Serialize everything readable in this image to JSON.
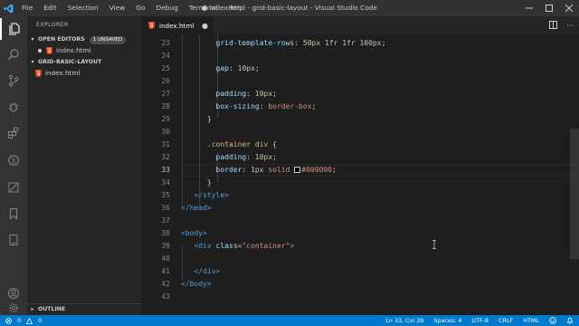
{
  "window": {
    "title": "● index.html - grid-basic-layout - Visual Studio Code",
    "menu": [
      "File",
      "Edit",
      "Selection",
      "View",
      "Go",
      "Debug",
      "Terminal",
      "Help"
    ],
    "controls": [
      "minimize-icon",
      "maximize-icon",
      "close-icon"
    ]
  },
  "activitybar": {
    "icons": [
      "files-icon",
      "search-icon",
      "source-control-icon",
      "debug-icon",
      "extensions-icon",
      "remote-icon",
      "deploy-icon",
      "bookmark-icon",
      "device-icon"
    ],
    "bottom_icons": [
      "account-icon",
      "settings-gear-icon"
    ]
  },
  "sidebar": {
    "title": "EXPLORER",
    "open_editors": {
      "label": "OPEN EDITORS",
      "badge": "1 UNSAVED",
      "files": [
        "index.html"
      ]
    },
    "project": {
      "label": "GRID-BASIC-LAYOUT",
      "files": [
        "index.html"
      ]
    },
    "outline_label": "OUTLINE"
  },
  "tabs": [
    {
      "label": "index.html",
      "dirty": true
    }
  ],
  "editor": {
    "line_numbers": [
      "23",
      "24",
      "25",
      "26",
      "27",
      "28",
      "29",
      "30",
      "31",
      "32",
      "33",
      "34",
      "35",
      "36",
      "37",
      "38",
      "39",
      "40",
      "41",
      "42",
      "43"
    ],
    "active_line": "33",
    "lines": {
      "l23": {
        "prop": "grid-template-rows",
        "val": "50px 1fr 1fr 100px"
      },
      "l25": {
        "prop": "gap",
        "val": "10px"
      },
      "l27": {
        "prop": "padding",
        "val": "10px"
      },
      "l28": {
        "prop": "box-sizing",
        "val": "border-box"
      },
      "l29": "}",
      "l31": {
        "selector": ".container div",
        "brace": "{"
      },
      "l32": {
        "prop": "padding",
        "val": "10px"
      },
      "l33": {
        "prop": "border",
        "val1": "1px",
        "val2": "solid",
        "color": "#000000"
      },
      "l34": "}",
      "l35": "</style>",
      "l36": "</head>",
      "l38": "<body>",
      "l39": {
        "tag": "<div",
        "attr": "class",
        "str": "\"container\"",
        "end": ">"
      },
      "l41": "</div>",
      "l42": "</body>"
    }
  },
  "statusbar": {
    "errors": "0",
    "warnings": "0",
    "position": "Ln 33, Col 39",
    "spaces": "Spaces: 4",
    "encoding": "UTF-8",
    "eol": "CRLF",
    "language": "HTML",
    "icons": [
      "error-icon",
      "warning-icon",
      "smiley-icon",
      "bell-icon"
    ]
  },
  "colors": {
    "accent": "#007acc",
    "titlebar": "#323233",
    "activitybar": "#333333",
    "sidebar": "#252526",
    "editor": "#1e1e1e",
    "html_icon": "#e44d26"
  }
}
